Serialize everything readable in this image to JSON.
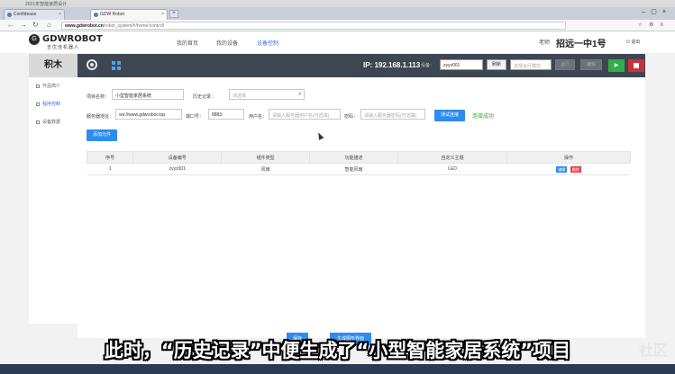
{
  "os": {
    "title": "2021年智能家居设计"
  },
  "browser": {
    "tabs": [
      {
        "label": "Confidease"
      },
      {
        "label": "GDW Robot"
      }
    ],
    "url_host": "www.gdwrobot.cn",
    "url_path": "/robot_system/#/home/controll"
  },
  "header": {
    "logo_text": "GDWROBOT",
    "logo_sub": "吉优佳机器人",
    "nav": [
      "我的首页",
      "我的设备",
      "设备控制"
    ],
    "teacher_label": "老师",
    "school_name": "招远一中1号",
    "logout_label": "退出"
  },
  "sidebar": {
    "title": "积木",
    "items": [
      "作品简介",
      "程序控制",
      "设备数据"
    ]
  },
  "toolbar": {
    "ip_label": "IP: 192.168.1.113",
    "count_label": "设备：",
    "device_value": "zyyz001",
    "refresh_label": "刷新",
    "mode_placeholder": "选择运行模式",
    "btn_a": "运行",
    "btn_b": "编辑"
  },
  "form": {
    "project_name_label": "项目名称：",
    "project_name_value": "小型智能家居系统",
    "history_label": "历史记录：",
    "history_placeholder": "请选择",
    "server_label": "服务器地址：",
    "server_value": "ws://www.gdwrobot.top",
    "port_label": "端口号：",
    "port_value": "8883",
    "user_label": "用户名：",
    "user_placeholder": "请输入服务器用户名(可选填)",
    "pass_label": "密码：",
    "pass_placeholder": "请输入服务器密码(可选填)",
    "test_button": "测试连接",
    "connect_status": "连接成功",
    "add_button": "添加元件"
  },
  "table": {
    "headers": [
      "序号",
      "设备编号",
      "组件类型",
      "功能描述",
      "自定义主题",
      "操作"
    ],
    "rows": [
      {
        "index": "1",
        "device": "zyyz001",
        "type": "风扇",
        "desc": "智能风扇",
        "topic": "LED"
      }
    ],
    "edit_label": "编辑",
    "delete_label": "删除"
  },
  "bottom": {
    "save_button": "保存",
    "generate_button": "生成图形界面"
  },
  "subtitle": "此时，“历史记录”中便生成了“小型智能家居系统”项目",
  "watermark": "社区"
}
